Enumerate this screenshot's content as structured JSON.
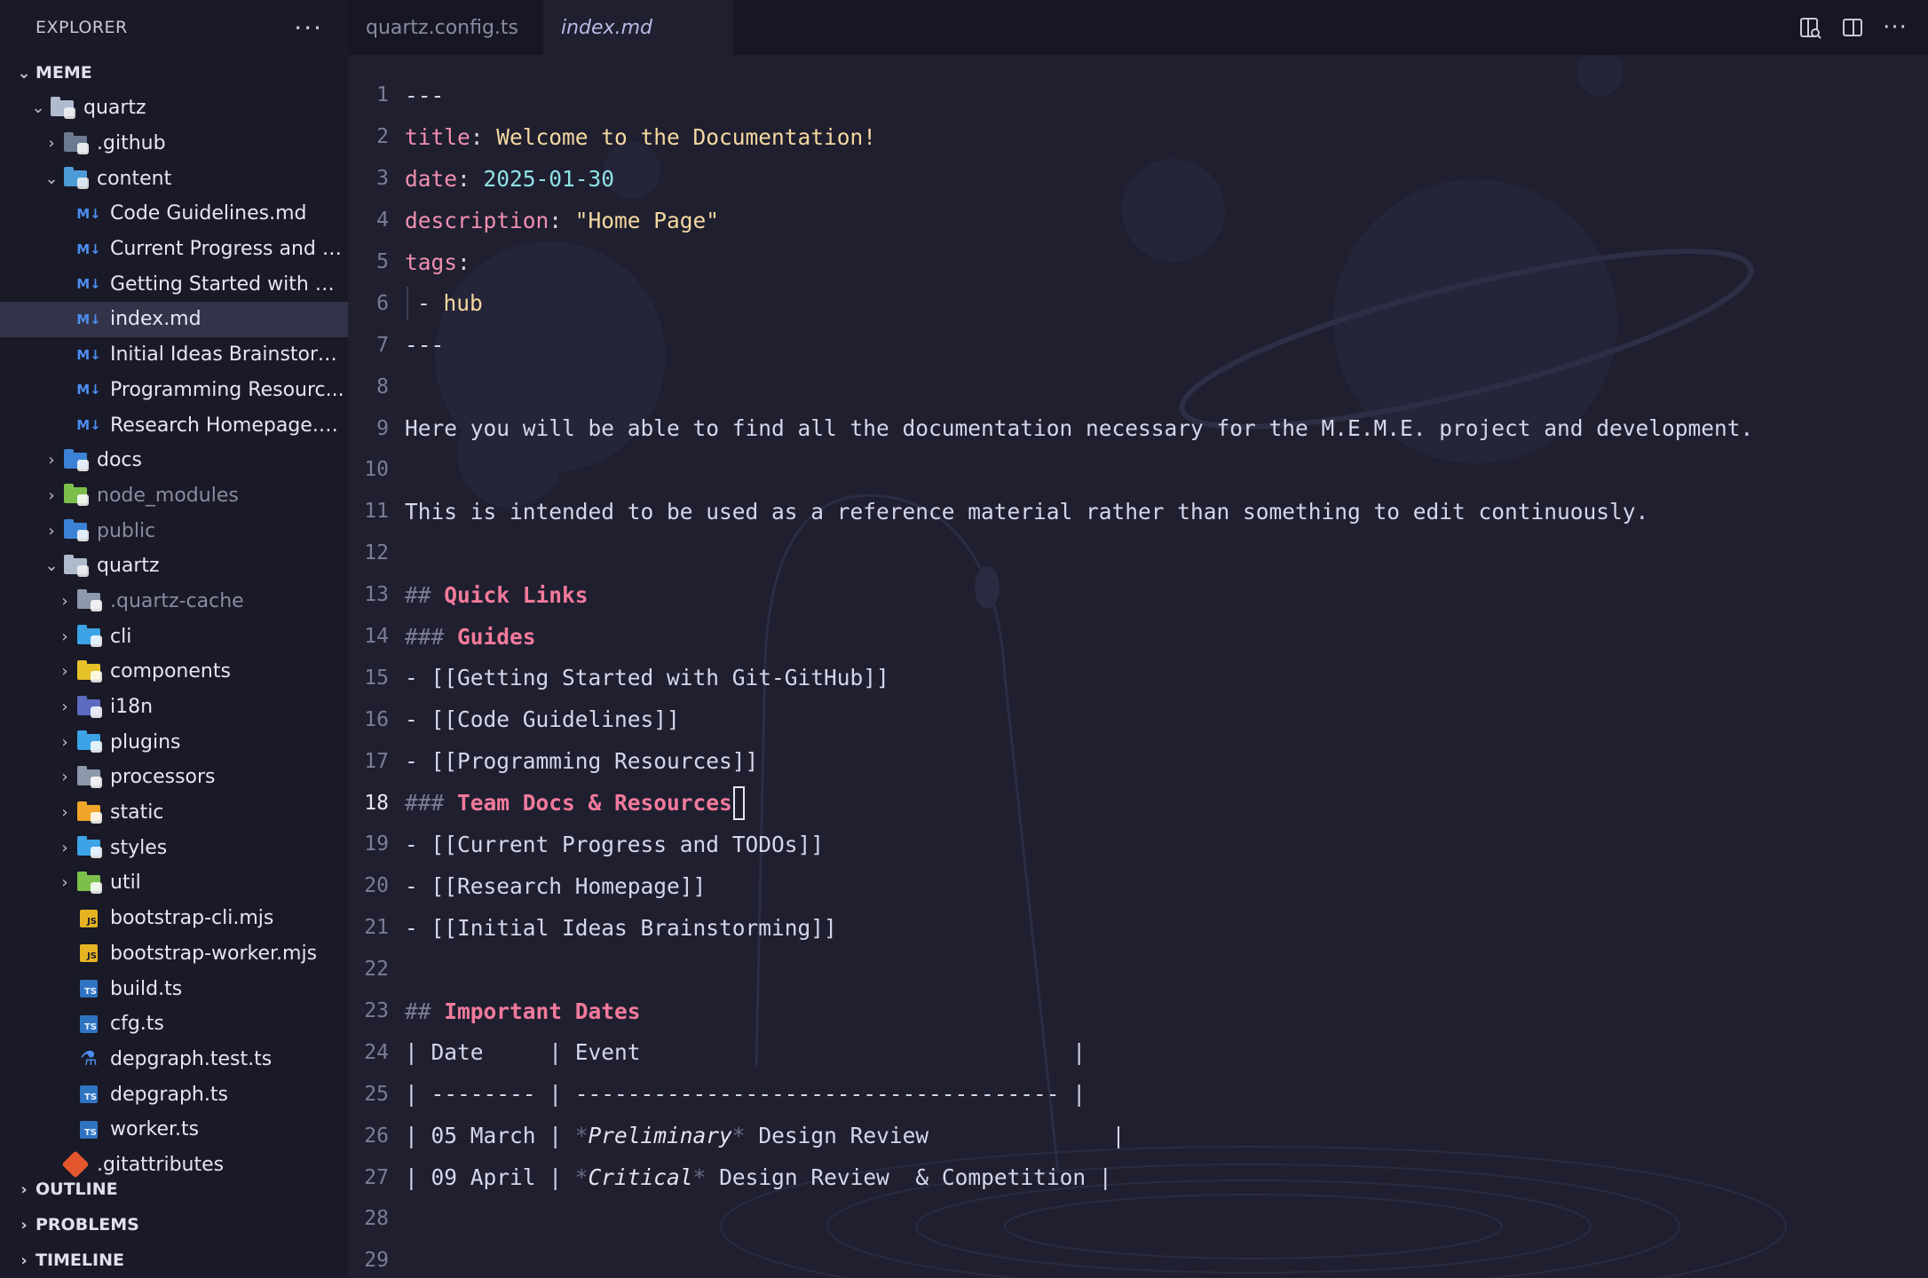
{
  "sidebar": {
    "title": "EXPLORER",
    "more_label": "···",
    "workspace": "MEME",
    "tree": [
      {
        "label": "quartz",
        "depth": 0,
        "kind": "folder-open",
        "chevron": "down",
        "color": "#b8c4d6"
      },
      {
        "label": ".github",
        "depth": 1,
        "kind": "folder",
        "chevron": "right",
        "color": "#6b7a90"
      },
      {
        "label": "content",
        "depth": 1,
        "kind": "folder-open",
        "chevron": "down",
        "color": "#4fa3e0"
      },
      {
        "label": "Code Guidelines.md",
        "depth": 2,
        "kind": "md"
      },
      {
        "label": "Current Progress and T...",
        "depth": 2,
        "kind": "md"
      },
      {
        "label": "Getting Started with Gi...",
        "depth": 2,
        "kind": "md"
      },
      {
        "label": "index.md",
        "depth": 2,
        "kind": "md",
        "selected": true
      },
      {
        "label": "Initial Ideas Brainstorm...",
        "depth": 2,
        "kind": "md"
      },
      {
        "label": "Programming Resourc...",
        "depth": 2,
        "kind": "md"
      },
      {
        "label": "Research Homepage.md",
        "depth": 2,
        "kind": "md"
      },
      {
        "label": "docs",
        "depth": 1,
        "kind": "folder",
        "chevron": "right",
        "color": "#3b82d6"
      },
      {
        "label": "node_modules",
        "depth": 1,
        "kind": "folder",
        "chevron": "right",
        "color": "#7cc04b",
        "dim": true
      },
      {
        "label": "public",
        "depth": 1,
        "kind": "folder",
        "chevron": "right",
        "color": "#3b82d6",
        "dim": true
      },
      {
        "label": "quartz",
        "depth": 1,
        "kind": "folder-open",
        "chevron": "down",
        "color": "#b8c4d6"
      },
      {
        "label": ".quartz-cache",
        "depth": 2,
        "kind": "folder",
        "chevron": "right",
        "color": "#8d99ab",
        "dim": true
      },
      {
        "label": "cli",
        "depth": 2,
        "kind": "folder",
        "chevron": "right",
        "color": "#3ba3e6"
      },
      {
        "label": "components",
        "depth": 2,
        "kind": "folder",
        "chevron": "right",
        "color": "#e6c229"
      },
      {
        "label": "i18n",
        "depth": 2,
        "kind": "folder",
        "chevron": "right",
        "color": "#5c6bc0"
      },
      {
        "label": "plugins",
        "depth": 2,
        "kind": "folder",
        "chevron": "right",
        "color": "#3ba3e6"
      },
      {
        "label": "processors",
        "depth": 2,
        "kind": "folder",
        "chevron": "right",
        "color": "#8d99ab"
      },
      {
        "label": "static",
        "depth": 2,
        "kind": "folder",
        "chevron": "right",
        "color": "#f0a429"
      },
      {
        "label": "styles",
        "depth": 2,
        "kind": "folder",
        "chevron": "right",
        "color": "#3ba3e6"
      },
      {
        "label": "util",
        "depth": 2,
        "kind": "folder",
        "chevron": "right",
        "color": "#7cc04b"
      },
      {
        "label": "bootstrap-cli.mjs",
        "depth": 2,
        "kind": "js"
      },
      {
        "label": "bootstrap-worker.mjs",
        "depth": 2,
        "kind": "js"
      },
      {
        "label": "build.ts",
        "depth": 2,
        "kind": "ts"
      },
      {
        "label": "cfg.ts",
        "depth": 2,
        "kind": "ts"
      },
      {
        "label": "depgraph.test.ts",
        "depth": 2,
        "kind": "test"
      },
      {
        "label": "depgraph.ts",
        "depth": 2,
        "kind": "ts"
      },
      {
        "label": "worker.ts",
        "depth": 2,
        "kind": "ts"
      },
      {
        "label": ".gitattributes",
        "depth": 1,
        "kind": "git"
      }
    ],
    "sections": [
      "OUTLINE",
      "PROBLEMS",
      "TIMELINE"
    ]
  },
  "tabs": [
    {
      "label": "quartz.config.ts",
      "active": false
    },
    {
      "label": "index.md",
      "active": true
    }
  ],
  "editor": {
    "current_line": 18,
    "lines": [
      [
        {
          "t": "---",
          "c": "plain"
        }
      ],
      [
        {
          "t": "title",
          "c": "key"
        },
        {
          "t": ": ",
          "c": "plain"
        },
        {
          "t": "Welcome to the Documentation!",
          "c": "str"
        }
      ],
      [
        {
          "t": "date",
          "c": "key"
        },
        {
          "t": ": ",
          "c": "plain"
        },
        {
          "t": "2025-01-30",
          "c": "date"
        }
      ],
      [
        {
          "t": "description",
          "c": "key"
        },
        {
          "t": ": ",
          "c": "plain"
        },
        {
          "t": "\"Home Page\"",
          "c": "str"
        }
      ],
      [
        {
          "t": "tags",
          "c": "key"
        },
        {
          "t": ":",
          "c": "plain"
        }
      ],
      [
        {
          "t": "",
          "c": "guide"
        },
        {
          "t": "- ",
          "c": "plain"
        },
        {
          "t": "hub",
          "c": "str"
        }
      ],
      [
        {
          "t": "---",
          "c": "plain"
        }
      ],
      [],
      [
        {
          "t": "Here you will be able to find all the documentation necessary for the M.E.M.E. project and development.",
          "c": "plain"
        }
      ],
      [],
      [
        {
          "t": "This is intended to be used as a reference material rather than something to edit continuously.",
          "c": "plain"
        }
      ],
      [],
      [
        {
          "t": "## ",
          "c": "hash"
        },
        {
          "t": "Quick Links",
          "c": "head"
        }
      ],
      [
        {
          "t": "### ",
          "c": "hash"
        },
        {
          "t": "Guides",
          "c": "head"
        }
      ],
      [
        {
          "t": "- [[Getting Started with Git-GitHub]]",
          "c": "plain"
        }
      ],
      [
        {
          "t": "- [[Code Guidelines]]",
          "c": "plain"
        }
      ],
      [
        {
          "t": "- [[Programming Resources]]",
          "c": "plain"
        }
      ],
      [
        {
          "t": "### ",
          "c": "hash"
        },
        {
          "t": "Team Docs & Resources",
          "c": "head"
        },
        {
          "t": "",
          "c": "cursor"
        }
      ],
      [
        {
          "t": "- [[Current Progress and TODOs]]",
          "c": "plain"
        }
      ],
      [
        {
          "t": "- [[Research Homepage]]",
          "c": "plain"
        }
      ],
      [
        {
          "t": "- [[Initial Ideas Brainstorming]]",
          "c": "plain"
        }
      ],
      [],
      [
        {
          "t": "## ",
          "c": "hash"
        },
        {
          "t": "Important Dates",
          "c": "head"
        }
      ],
      [
        {
          "t": "| Date     | Event                                 |",
          "c": "plain"
        }
      ],
      [
        {
          "t": "| -------- | ------------------------------------- |",
          "c": "plain"
        }
      ],
      [
        {
          "t": "| 05 March | ",
          "c": "plain"
        },
        {
          "t": "*",
          "c": "star"
        },
        {
          "t": "Preliminary",
          "c": "italic"
        },
        {
          "t": "*",
          "c": "star"
        },
        {
          "t": " Design Review              |",
          "c": "plain"
        }
      ],
      [
        {
          "t": "| 09 April | ",
          "c": "plain"
        },
        {
          "t": "*",
          "c": "star"
        },
        {
          "t": "Critical",
          "c": "italic"
        },
        {
          "t": "*",
          "c": "star"
        },
        {
          "t": " Design Review  & Competition |",
          "c": "plain"
        }
      ],
      [],
      [],
      []
    ]
  }
}
